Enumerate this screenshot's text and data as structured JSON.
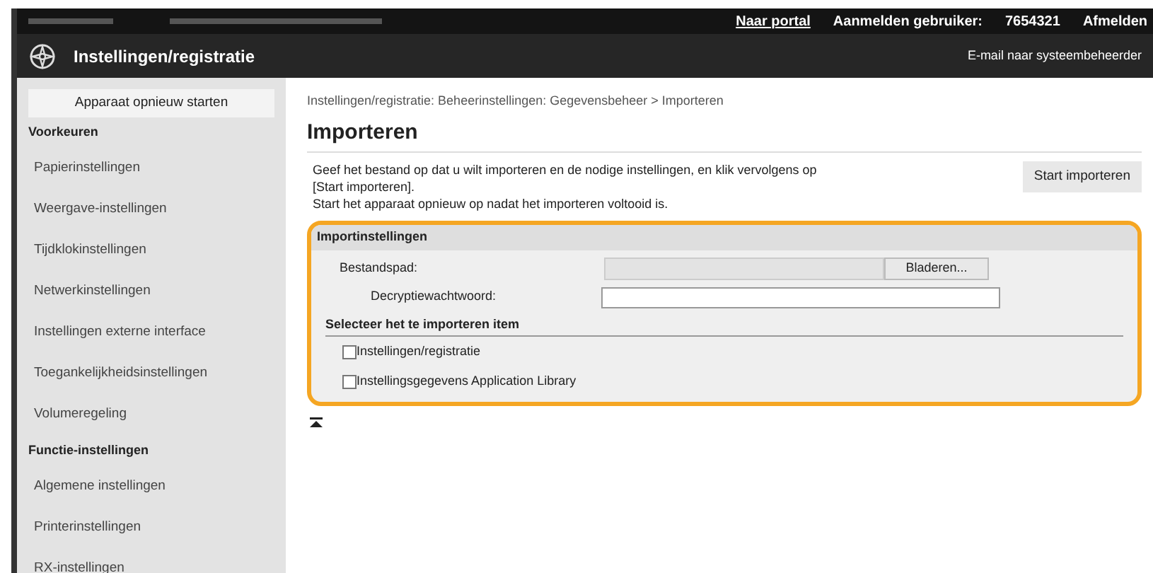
{
  "top_bar": {
    "links": [
      "Naar portal",
      "Aanmelden gebruiker:",
      "7654321",
      "Afmelden"
    ]
  },
  "header": {
    "title": "Instellingen/registratie",
    "mail_link": "E-mail naar systeembeheerder"
  },
  "sidebar": {
    "restart_button": "Apparaat opnieuw starten",
    "sections": [
      {
        "heading": "Voorkeuren",
        "items": [
          "Papierinstellingen",
          "Weergave-instellingen",
          "Tijdklokinstellingen",
          "Netwerkinstellingen",
          "Instellingen externe interface",
          "Toegankelijkheidsinstellingen",
          "Volumeregeling"
        ]
      },
      {
        "heading": "Functie-instellingen",
        "items": [
          "Algemene instellingen",
          "Printerinstellingen",
          "RX-instellingen"
        ]
      }
    ]
  },
  "breadcrumb": "Instellingen/registratie: Beheerinstellingen: Gegevensbeheer > Importeren",
  "page_title": "Importeren",
  "description": [
    "Geef het bestand op dat u wilt importeren en de nodige instellingen, en klik vervolgens op [Start importeren].",
    "Start het apparaat opnieuw op nadat het importeren voltooid is."
  ],
  "start_button": "Start importeren",
  "import_settings": {
    "heading": "Importinstellingen",
    "file_path_label": "Bestandspad:",
    "browse_button": "Bladeren...",
    "password_label": "Decryptiewachtwoord:",
    "select_heading": "Selecteer het te importeren item",
    "items": [
      {
        "label": "Instellingen/registratie",
        "checked": false
      },
      {
        "label": "Instellingsgegevens Application Library",
        "checked": false
      }
    ]
  }
}
